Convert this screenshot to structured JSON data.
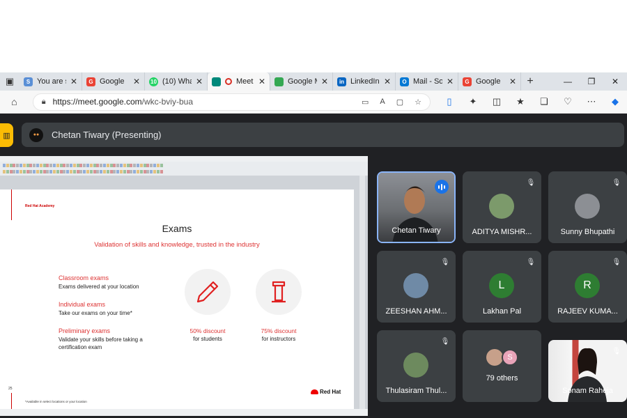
{
  "browser": {
    "tabs": [
      {
        "label": "You are si",
        "favicon_color": "#5a8fd6",
        "favicon_char": "S"
      },
      {
        "label": "Google",
        "favicon_color": "#ea4335",
        "favicon_char": "G"
      },
      {
        "label": "(10) What",
        "favicon_color": "#25d366",
        "favicon_char": "10"
      },
      {
        "label": "Meet",
        "favicon_color": "#00897b",
        "favicon_char": "",
        "active": true
      },
      {
        "label": "Google M",
        "favicon_color": "#34a853",
        "favicon_char": ""
      },
      {
        "label": "LinkedIn |",
        "favicon_color": "#0a66c2",
        "favicon_char": "in"
      },
      {
        "label": "Mail - Sor",
        "favicon_color": "#0078d4",
        "favicon_char": "O"
      },
      {
        "label": "Google",
        "favicon_color": "#ea4335",
        "favicon_char": "G"
      }
    ],
    "new_tab_glyph": "+",
    "url_host": "https://meet.google.com",
    "url_path": "/wkc-bviy-bua"
  },
  "meet": {
    "presenter_label": "Chetan Tiwary (Presenting)",
    "slide": {
      "academy": "Red Hat Academy",
      "title": "Exams",
      "subtitle": "Validation of skills and knowledge, trusted in the industry",
      "exams": [
        {
          "heading": "Classroom exams",
          "desc": "Exams delivered at your location"
        },
        {
          "heading": "Individual exams",
          "desc": "Take our exams on your time*"
        },
        {
          "heading": "Preliminary exams",
          "desc": "Validate your skills before taking a certification exam"
        }
      ],
      "discounts": [
        {
          "percent": "50% discount",
          "for": "for students"
        },
        {
          "percent": "75% discount",
          "for": "for instructors"
        }
      ],
      "page_number": "25",
      "footnote": "*Available in select locations or your location",
      "brand": "Red Hat"
    },
    "participants": [
      {
        "name": "Chetan Tiwary",
        "speaking": true
      },
      {
        "name": "ADITYA MISHR...",
        "muted": true
      },
      {
        "name": "Sunny Bhupathi",
        "muted": true
      },
      {
        "name": "ZEESHAN AHM...",
        "muted": true
      },
      {
        "name": "Lakhan Pal",
        "initial": "L",
        "muted": true
      },
      {
        "name": "RAJEEV KUMA...",
        "initial": "R",
        "muted": true
      },
      {
        "name": "Thulasiram Thul...",
        "muted": true
      },
      {
        "name": "79 others"
      },
      {
        "name": "Sonam Raheja",
        "muted": true
      }
    ],
    "others_avatar_initial": "S",
    "colors": {
      "stage": "#202124",
      "tile": "#3c4043",
      "accent": "#fbbc04",
      "speaking_border": "#8ab4f8"
    }
  }
}
